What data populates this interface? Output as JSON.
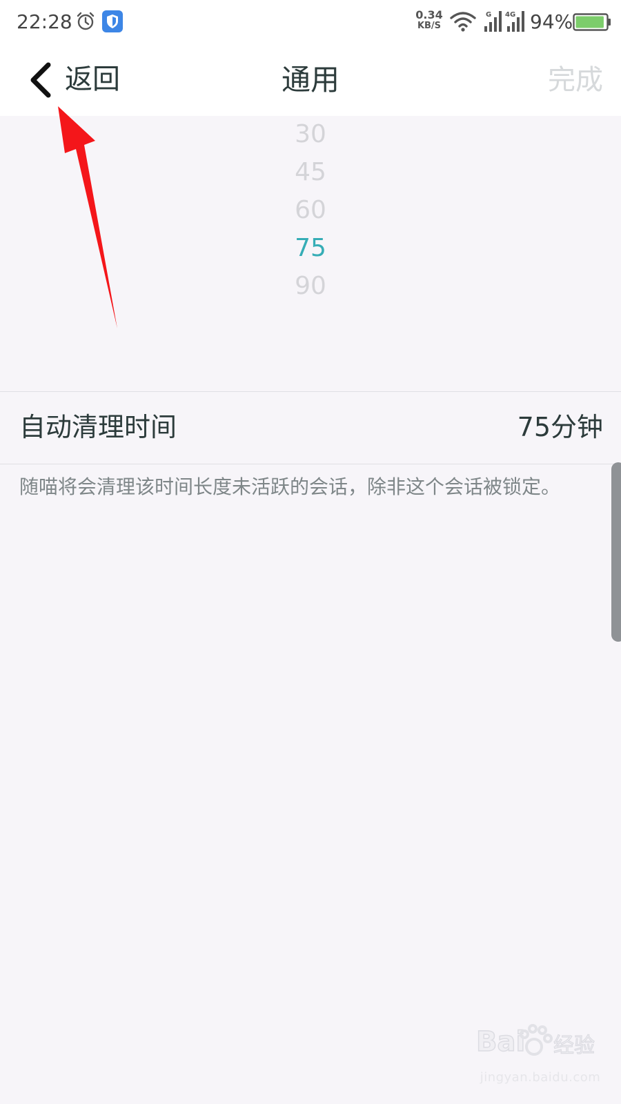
{
  "status_bar": {
    "time": "22:28",
    "net_speed_value": "0.34",
    "net_speed_unit": "KB/S",
    "sig1_tag": "G",
    "sig2_tag": "4G",
    "battery_percent": "94%",
    "battery_level": 0.94,
    "icons": [
      "alarm-icon",
      "shield-icon",
      "wifi-icon",
      "signal-icon",
      "signal-4g-icon",
      "battery-icon"
    ]
  },
  "nav": {
    "back_label": "返回",
    "title": "通用",
    "done_label": "完成"
  },
  "picker": {
    "options": [
      "30",
      "45",
      "60",
      "75",
      "90"
    ],
    "selected": "75",
    "selected_color": "#36adb6"
  },
  "setting": {
    "label": "自动清理时间",
    "value": "75分钟"
  },
  "description": "随喵将会清理该时间长度未活跃的会话，除非这个会话被锁定。",
  "watermark": {
    "brand": "Baidu 经验",
    "url": "jingyan.baidu.com"
  },
  "colors": {
    "accent": "#36adb6",
    "arrow": "#f4161a",
    "background": "#f7f5f9"
  }
}
